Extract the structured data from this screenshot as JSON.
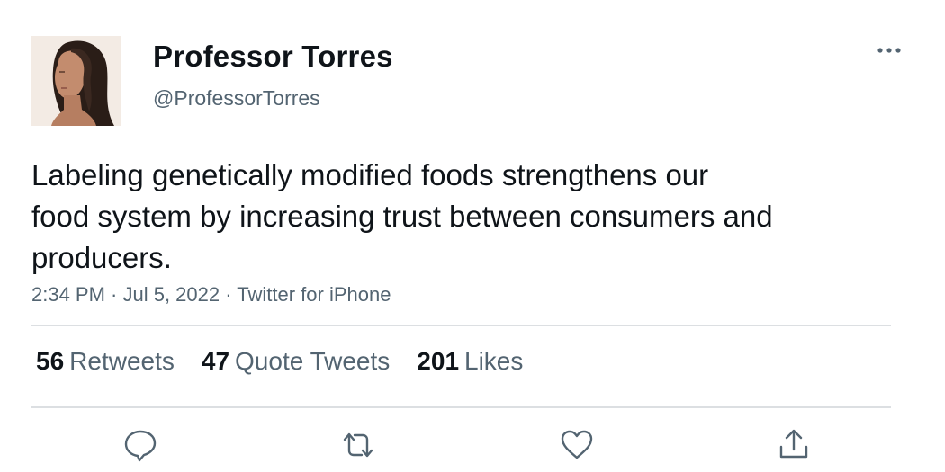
{
  "tweet": {
    "display_name": "Professor Torres",
    "handle": "@ProfessorTorres",
    "text": "Labeling genetically modified foods strengthens our\nfood system by increasing trust between consumers and\nproducers.",
    "meta": "2:34 PM · Jul 5, 2022 · Twitter for iPhone"
  },
  "stats": [
    {
      "count": "56",
      "label": "Retweets"
    },
    {
      "count": "47",
      "label": "Quote Tweets"
    },
    {
      "count": "201",
      "label": "Likes"
    }
  ],
  "icons": {
    "more": "more-dots-icon",
    "reply": "reply-bubble-icon",
    "retweet": "retweet-arrows-icon",
    "like": "heart-icon",
    "share": "share-upload-icon"
  },
  "colors": {
    "text_primary": "#0f1419",
    "text_secondary": "#536471",
    "divider": "#dcdfe2"
  }
}
